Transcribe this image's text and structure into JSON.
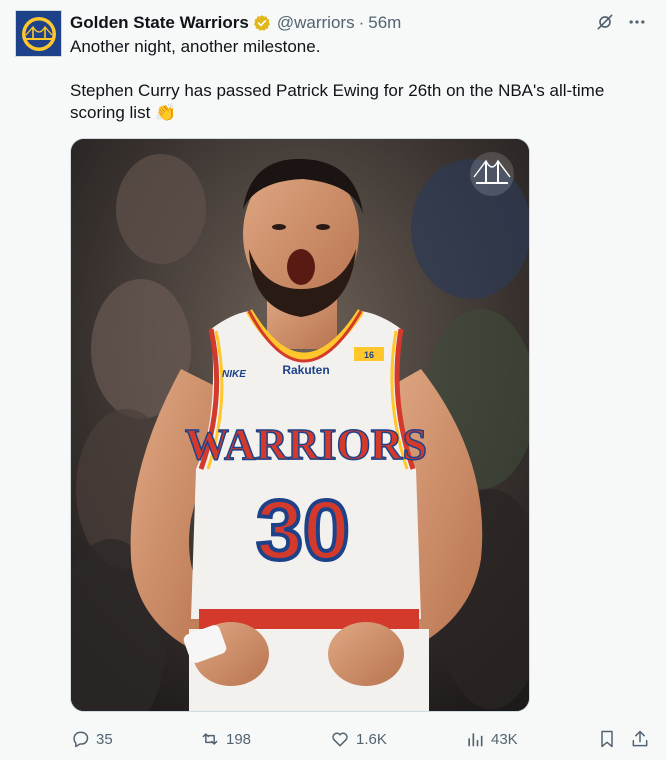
{
  "tweet": {
    "author": {
      "name": "Golden State Warriors",
      "handle": "@warriors",
      "verified_icon": "verified-gold-badge",
      "avatar": "warriors-bridge-logo"
    },
    "separator": "·",
    "time": "56m",
    "text_line1": "Another night, another milestone.",
    "text_line2": "Stephen Curry has passed Patrick Ewing for 26th on the NBA's all-time scoring list 👏",
    "media": {
      "jersey_team": "WARRIORS",
      "jersey_number": "30",
      "jersey_sponsor": "Rakuten",
      "jersey_brand": "NIKE",
      "badge_number": "16",
      "watermark": "warriors-bridge-logo"
    },
    "actions": {
      "replies": "35",
      "reposts": "198",
      "likes": "1.6K",
      "views": "43K"
    }
  },
  "colors": {
    "warriors_blue": "#1d428a",
    "warriors_gold": "#ffc72c",
    "verified_gold": "#e2b719",
    "text_primary": "#0f1419",
    "text_secondary": "#536471",
    "background": "#f7f9f9"
  }
}
